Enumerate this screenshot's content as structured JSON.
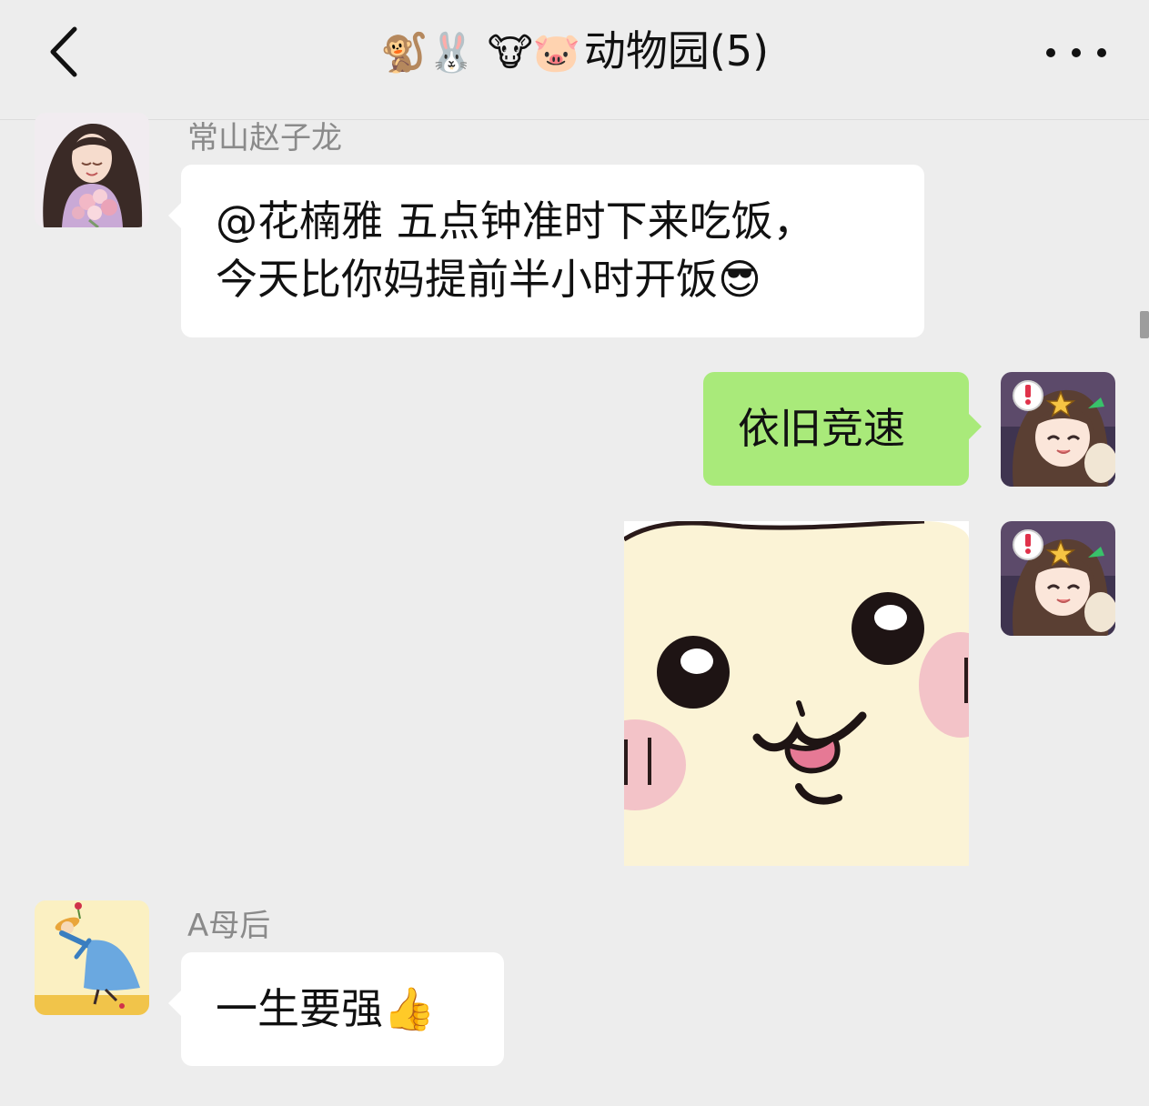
{
  "header": {
    "back_icon": "chevron-left-icon",
    "title_emojis": "🐒🐰 🐮🐷",
    "title_text": "动物园(5)",
    "more_icon": "more-dots-icon"
  },
  "messages": [
    {
      "sender": "常山赵子龙",
      "line1": "@花楠雅  五点钟准时下来吃饭，",
      "line2": "今天比你妈提前半小时开饭😎"
    },
    {
      "text": "依旧竞速"
    },
    {
      "sticker": "cute-yellow-face-sticker"
    },
    {
      "sender": "A母后",
      "text": "一生要强👍"
    }
  ],
  "colors": {
    "background": "#ededed",
    "incoming_bubble": "#ffffff",
    "outgoing_bubble": "#a9ea7a",
    "sender_name": "#8a8a8a"
  }
}
